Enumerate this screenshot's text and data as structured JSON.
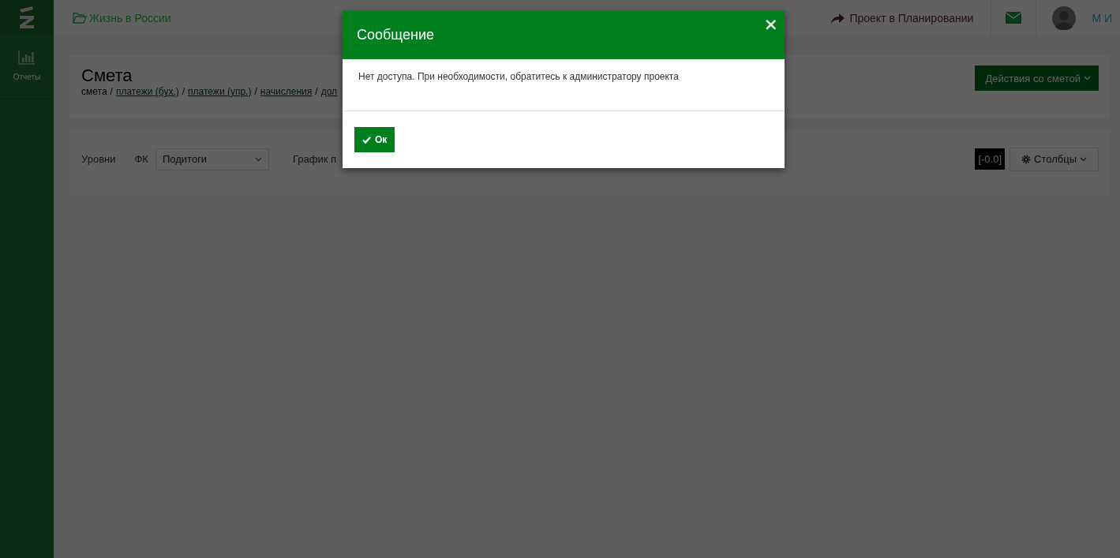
{
  "sidebar": {
    "items": [
      {
        "label": "Отчеты"
      }
    ]
  },
  "topbar": {
    "project": "Жизнь в России",
    "status": "Проект в Планировании",
    "user": "М И"
  },
  "header": {
    "title": "Смета",
    "actions_button": "Действия со сметой",
    "separator": "/",
    "breadcrumb": [
      {
        "label": "смета",
        "kind": "text"
      },
      {
        "label": "платежи (бух.)",
        "kind": "link"
      },
      {
        "label": "платежи (упр.)",
        "kind": "link"
      },
      {
        "label": "начисления",
        "kind": "link"
      },
      {
        "label": "дол",
        "kind": "link"
      }
    ]
  },
  "filters": {
    "levels_label": "Уровни",
    "fk_label": "ФК",
    "fk_value": "Подитоги",
    "schedule_label": "График п",
    "total": "[-0.0]",
    "columns_button": "Столбцы"
  },
  "dialog": {
    "title": "Сообщение",
    "close": "×",
    "message": "Нет доступа. При необходимости, обратитесь к администратору проекта",
    "ok_button": "Ок"
  }
}
